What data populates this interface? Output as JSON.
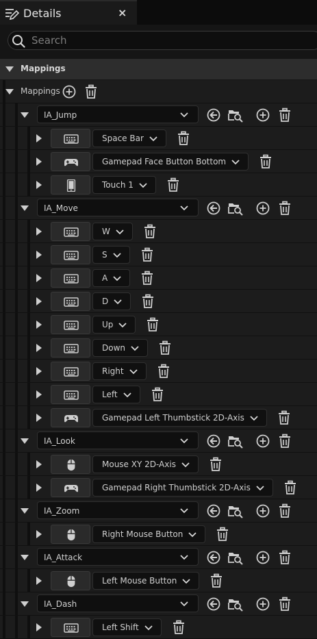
{
  "panel": {
    "tab_title": "Details",
    "close_glyph": "×"
  },
  "search": {
    "placeholder": "Search",
    "value": ""
  },
  "category": {
    "title": "Mappings"
  },
  "mappings_row": {
    "label": "Mappings"
  },
  "actions": [
    {
      "name": "IA_Jump",
      "keys": [
        {
          "device": "keyboard",
          "key": "Space Bar"
        },
        {
          "device": "gamepad",
          "key": "Gamepad Face Button Bottom"
        },
        {
          "device": "touch",
          "key": "Touch 1"
        }
      ]
    },
    {
      "name": "IA_Move",
      "keys": [
        {
          "device": "keyboard",
          "key": "W"
        },
        {
          "device": "keyboard",
          "key": "S"
        },
        {
          "device": "keyboard",
          "key": "A"
        },
        {
          "device": "keyboard",
          "key": "D"
        },
        {
          "device": "keyboard",
          "key": "Up"
        },
        {
          "device": "keyboard",
          "key": "Down"
        },
        {
          "device": "keyboard",
          "key": "Right"
        },
        {
          "device": "keyboard",
          "key": "Left"
        },
        {
          "device": "gamepad",
          "key": "Gamepad Left Thumbstick 2D-Axis"
        }
      ]
    },
    {
      "name": "IA_Look",
      "keys": [
        {
          "device": "mouse",
          "key": "Mouse XY 2D-Axis"
        },
        {
          "device": "gamepad",
          "key": "Gamepad Right Thumbstick 2D-Axis"
        }
      ]
    },
    {
      "name": "IA_Zoom",
      "keys": [
        {
          "device": "mouse",
          "key": "Right Mouse Button"
        }
      ]
    },
    {
      "name": "IA_Attack",
      "keys": [
        {
          "device": "mouse",
          "key": "Left Mouse Button"
        }
      ]
    },
    {
      "name": "IA_Dash",
      "keys": [
        {
          "device": "keyboard",
          "key": "Left Shift"
        }
      ]
    }
  ],
  "icons": {
    "panel": "edit-details-icon",
    "search": "search-icon",
    "add": "add-circle-icon",
    "delete": "trash-icon",
    "use_selected": "use-selected-arrow-icon",
    "browse": "browse-folder-icon",
    "keyboard": "keyboard-icon",
    "gamepad": "gamepad-icon",
    "mouse": "mouse-icon",
    "touch": "touch-device-icon"
  },
  "colors": {
    "background": "#151515",
    "row": "#1c1c1c",
    "header": "#2d2d2d",
    "field": "#0f0f0f",
    "text": "#c8c8c8"
  }
}
